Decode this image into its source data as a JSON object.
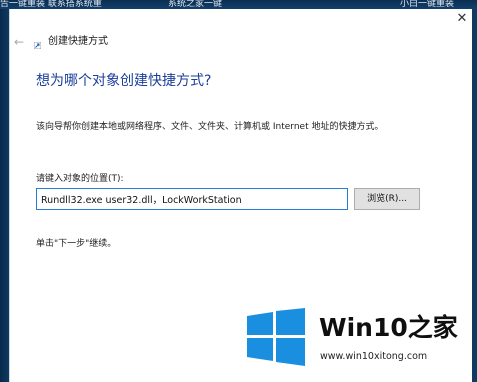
{
  "desktop": {
    "taskbar_texts": [
      "告一键重装 联系搭系统重",
      "系统之家一键",
      "小白一键重装"
    ]
  },
  "window": {
    "close_glyph": "✕",
    "back_glyph": "←",
    "title": "创建快捷方式"
  },
  "main": {
    "heading": "想为哪个对象创建快捷方式?",
    "description": "该向导帮你创建本地或网络程序、文件、文件夹、计算机或 Internet 地址的快捷方式。",
    "location_label": "请键入对象的位置(T):",
    "location_value": "Rundll32.exe user32.dll，LockWorkStation",
    "browse_label": "浏览(R)...",
    "hint": "单击\"下一步\"继续。"
  },
  "watermark": {
    "brand_prefix": "Win10",
    "brand_suffix": "之家",
    "url": "www.win10xitong.com",
    "colors": {
      "logo": "#1a8fe0",
      "text": "#111111"
    }
  }
}
